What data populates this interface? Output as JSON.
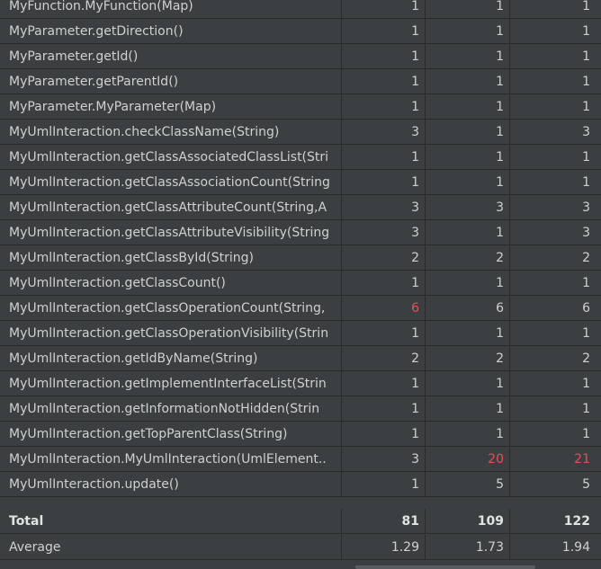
{
  "rows": [
    {
      "method": "MyFunction.MyFunction(Map)",
      "v1": "1",
      "v2": "1",
      "v3": "1"
    },
    {
      "method": "MyParameter.getDirection()",
      "v1": "1",
      "v2": "1",
      "v3": "1"
    },
    {
      "method": "MyParameter.getId()",
      "v1": "1",
      "v2": "1",
      "v3": "1"
    },
    {
      "method": "MyParameter.getParentId()",
      "v1": "1",
      "v2": "1",
      "v3": "1"
    },
    {
      "method": "MyParameter.MyParameter(Map)",
      "v1": "1",
      "v2": "1",
      "v3": "1"
    },
    {
      "method": "MyUmlInteraction.checkClassName(String)",
      "v1": "3",
      "v2": "1",
      "v3": "3"
    },
    {
      "method": "MyUmlInteraction.getClassAssociatedClassList(Stri",
      "v1": "1",
      "v2": "1",
      "v3": "1"
    },
    {
      "method": "MyUmlInteraction.getClassAssociationCount(String",
      "v1": "1",
      "v2": "1",
      "v3": "1"
    },
    {
      "method": "MyUmlInteraction.getClassAttributeCount(String,A",
      "v1": "3",
      "v2": "3",
      "v3": "3"
    },
    {
      "method": "MyUmlInteraction.getClassAttributeVisibility(String",
      "v1": "3",
      "v2": "1",
      "v3": "3"
    },
    {
      "method": "MyUmlInteraction.getClassById(String)",
      "v1": "2",
      "v2": "2",
      "v3": "2"
    },
    {
      "method": "MyUmlInteraction.getClassCount()",
      "v1": "1",
      "v2": "1",
      "v3": "1"
    },
    {
      "method": "MyUmlInteraction.getClassOperationCount(String,",
      "v1": "6",
      "v2": "6",
      "v3": "6",
      "red1": true
    },
    {
      "method": "MyUmlInteraction.getClassOperationVisibility(Strin",
      "v1": "1",
      "v2": "1",
      "v3": "1"
    },
    {
      "method": "MyUmlInteraction.getIdByName(String)",
      "v1": "2",
      "v2": "2",
      "v3": "2"
    },
    {
      "method": "MyUmlInteraction.getImplementInterfaceList(Strin",
      "v1": "1",
      "v2": "1",
      "v3": "1"
    },
    {
      "method": "MyUmlInteraction.getInformationNotHidden(Strin",
      "v1": "1",
      "v2": "1",
      "v3": "1"
    },
    {
      "method": "MyUmlInteraction.getTopParentClass(String)",
      "v1": "1",
      "v2": "1",
      "v3": "1"
    },
    {
      "method": "MyUmlInteraction.MyUmlInteraction(UmlElement..",
      "v1": "3",
      "v2": "20",
      "v3": "21",
      "red2": true,
      "red3": true
    },
    {
      "method": "MyUmlInteraction.update()",
      "v1": "1",
      "v2": "5",
      "v3": "5"
    }
  ],
  "total": {
    "label": "Total",
    "v1": "81",
    "v2": "109",
    "v3": "122"
  },
  "average": {
    "label": "Average",
    "v1": "1.29",
    "v2": "1.73",
    "v3": "1.94"
  },
  "colors": {
    "highlight": "#e0525a",
    "background": "#3c3f41",
    "grid": "#2b2b2b"
  }
}
